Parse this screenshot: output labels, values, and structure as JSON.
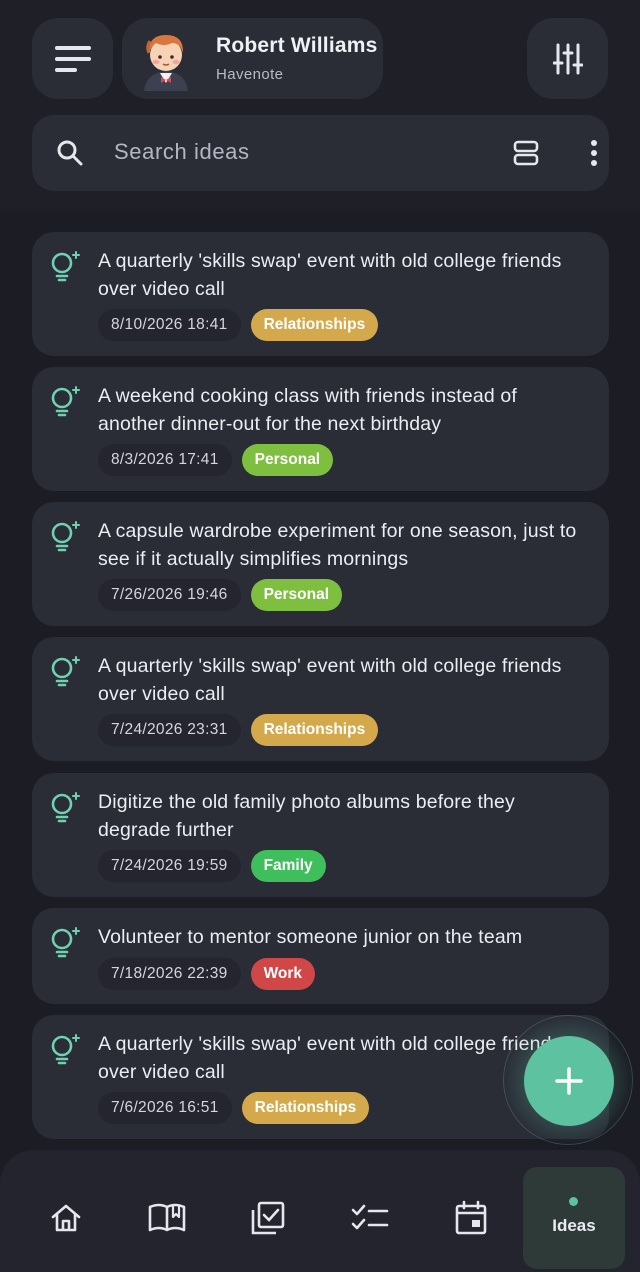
{
  "header": {
    "user_name": "Robert Williams",
    "app_name": "Havenote",
    "menu_icon": "menu-icon",
    "filter_icon": "sliders-icon"
  },
  "search": {
    "placeholder": "Search ideas",
    "layout_icon": "view-agenda-icon",
    "more_icon": "more-vert-icon"
  },
  "colors": {
    "Relationships": "#d3a94b",
    "Personal": "#7fbf3f",
    "Family": "#3fbf5c",
    "Work": "#cf4747",
    "accent": "#5cc2a0"
  },
  "ideas": [
    {
      "title": "A quarterly 'skills swap' event with old college friends over video call",
      "date": "8/10/2026 18:41",
      "tag": "Relationships"
    },
    {
      "title": "A weekend cooking class with friends instead of another dinner-out for the next birthday",
      "date": "8/3/2026 17:41",
      "tag": "Personal"
    },
    {
      "title": "A capsule wardrobe experiment for one season, just to see if it actually simplifies mornings",
      "date": "7/26/2026 19:46",
      "tag": "Personal"
    },
    {
      "title": "A quarterly 'skills swap' event with old college friends over video call",
      "date": "7/24/2026 23:31",
      "tag": "Relationships"
    },
    {
      "title": "Digitize the old family photo albums before they degrade further",
      "date": "7/24/2026 19:59",
      "tag": "Family"
    },
    {
      "title": "Volunteer to mentor someone junior on the team",
      "date": "7/18/2026 22:39",
      "tag": "Work"
    },
    {
      "title": "A quarterly 'skills swap' event with old college friends over video call",
      "date": "7/6/2026 16:51",
      "tag": "Relationships"
    }
  ],
  "fab": {
    "icon": "plus-icon"
  },
  "nav": {
    "items": [
      {
        "icon": "home-icon"
      },
      {
        "icon": "book-icon"
      },
      {
        "icon": "checkbox-icon"
      },
      {
        "icon": "checklist-icon"
      },
      {
        "icon": "calendar-icon"
      }
    ],
    "active_label": "Ideas"
  }
}
